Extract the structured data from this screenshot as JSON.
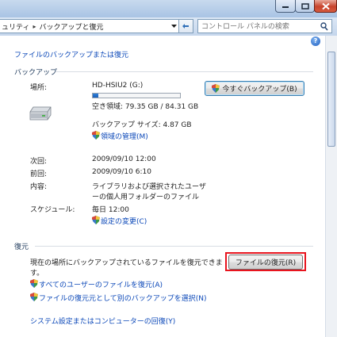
{
  "window": {
    "minimize_icon": "minimize-icon",
    "maximize_icon": "maximize-icon",
    "close_icon": "close-icon"
  },
  "address": {
    "breadcrumbs": [
      "ュリティ",
      "バックアップと復元"
    ],
    "search_placeholder": "コントロール パネルの検索"
  },
  "page": {
    "top_link": "ファイルのバックアップまたは復元",
    "backup": {
      "heading": "バックアップ",
      "location_label": "場所:",
      "drive_name": "HD-HSIU2 (G:)",
      "drive_used_fraction": 0.06,
      "free_space": "空き領域: 79.35 GB / 84.31 GB",
      "backup_size": "バックアップ サイズ: 4.87 GB",
      "manage_space_link": "領域の管理(M)",
      "backup_now_button": "今すぐバックアップ(B)",
      "next_label": "次回:",
      "next_value": "2009/09/10 12:00",
      "last_label": "前回:",
      "last_value": "2009/09/10 6:10",
      "contents_label": "内容:",
      "contents_line1": "ライブラリおよび選択されたユーザ",
      "contents_line2": "ーの個人用フォルダーのファイル",
      "schedule_label": "スケジュール:",
      "schedule_value": "毎日 12:00",
      "change_settings_link": "設定の変更(C)"
    },
    "restore": {
      "heading": "復元",
      "description_line1": "現在の場所にバックアップされているファイルを復元できま",
      "description_line2": "す。",
      "restore_files_button": "ファイルの復元(R)",
      "restore_all_users_link": "すべてのユーザーのファイルを復元(A)",
      "select_other_backup_link": "ファイルの復元元として別のバックアップを選択(N)",
      "recover_system_link": "システム設定またはコンピューターの回復(Y)"
    }
  },
  "colors": {
    "link": "#0a47b8",
    "highlight_border": "#e8141e",
    "progress_fill": "#1a5fb8"
  }
}
